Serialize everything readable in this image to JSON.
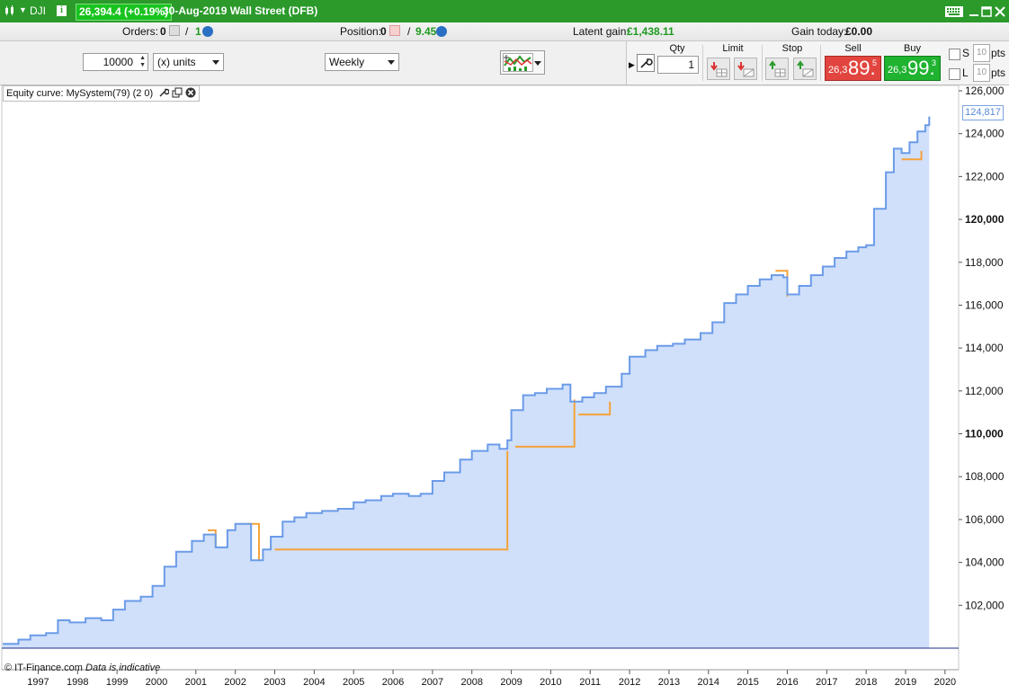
{
  "titlebar": {
    "symbol": "DJI",
    "price_change": "26,394.4 (+0.19%)",
    "market": "30-Aug-2019  Wall Street (DFB)"
  },
  "status": {
    "orders_label": "Orders:",
    "orders_count": "0",
    "orders_sep": "/",
    "orders_pending": "1",
    "position_label": "Position:",
    "position_count": "0",
    "position_sep": "/",
    "position_value": "9.45",
    "latent_label": "Latent gain:",
    "latent_value": "£1,438.11",
    "gain_today_label": "Gain today:",
    "gain_today_value": "£0.00"
  },
  "toolbar": {
    "quantity": "10000",
    "units": "(x) units",
    "period": "Weekly"
  },
  "deal": {
    "qty_label": "Qty",
    "qty_value": "1",
    "limit_label": "Limit",
    "stop_label": "Stop",
    "sell_label": "Sell",
    "buy_label": "Buy",
    "sell_prefix": "26,3",
    "sell_big": "89.",
    "sell_sup": "5",
    "buy_prefix": "26,3",
    "buy_big": "99.",
    "buy_sup": "3",
    "s_label": "S",
    "l_label": "L",
    "pts_value": "10",
    "pts_label": "pts"
  },
  "chart": {
    "legend": "Equity curve: MySystem(79) (2 0)",
    "copyright": "© IT-Finance.com",
    "copyright_note": "Data is indicative",
    "last_value_label": "124,817"
  },
  "chart_data": {
    "type": "area",
    "title": "Equity curve: MySystem(79) (2 0)",
    "xlabel": "",
    "ylabel": "",
    "ylim": [
      100000,
      126000
    ],
    "xlim": [
      1996.1,
      2020.3
    ],
    "x_ticks": [
      "1997",
      "1998",
      "1999",
      "2000",
      "2001",
      "2002",
      "2003",
      "2004",
      "2005",
      "2006",
      "2007",
      "2008",
      "2009",
      "2010",
      "2011",
      "2012",
      "2013",
      "2014",
      "2015",
      "2016",
      "2017",
      "2018",
      "2019",
      "2020"
    ],
    "y_ticks": [
      "102,000",
      "104,000",
      "106,000",
      "108,000",
      "110,000",
      "112,000",
      "114,000",
      "116,000",
      "118,000",
      "120,000",
      "122,000",
      "124,000",
      "126,000"
    ],
    "y_ticks_bold": [
      "110,000",
      "120,000"
    ],
    "colors": {
      "line": "#6b9be8",
      "drawdown": "#f5a23a",
      "fill": "#d0e0fa",
      "baseline": "#1c2c8c"
    },
    "x": [
      1996.1,
      1996.5,
      1996.8,
      1997.2,
      1997.5,
      1997.8,
      1998.2,
      1998.6,
      1998.9,
      1999.2,
      1999.6,
      1999.9,
      2000.2,
      2000.5,
      2000.9,
      2001.2,
      2001.5,
      2001.8,
      2002.0,
      2002.4,
      2002.7,
      2002.9,
      2003.2,
      2003.5,
      2003.8,
      2004.2,
      2004.6,
      2005.0,
      2005.3,
      2005.7,
      2006.0,
      2006.4,
      2006.7,
      2007.0,
      2007.3,
      2007.7,
      2008.0,
      2008.4,
      2008.7,
      2008.9,
      2009.0,
      2009.3,
      2009.6,
      2009.9,
      2010.3,
      2010.5,
      2010.8,
      2011.1,
      2011.4,
      2011.8,
      2012.0,
      2012.4,
      2012.7,
      2013.1,
      2013.4,
      2013.8,
      2014.1,
      2014.4,
      2014.7,
      2015.0,
      2015.3,
      2015.6,
      2015.9,
      2016.0,
      2016.3,
      2016.6,
      2016.9,
      2017.2,
      2017.5,
      2017.8,
      2018.0,
      2018.2,
      2018.5,
      2018.7,
      2018.9,
      2019.1,
      2019.3,
      2019.5,
      2019.6
    ],
    "y": [
      100200,
      100400,
      100600,
      100700,
      101300,
      101200,
      101400,
      101300,
      101800,
      102200,
      102400,
      102900,
      103800,
      104500,
      105000,
      105300,
      104700,
      105500,
      105800,
      104100,
      104600,
      105200,
      105900,
      106100,
      106300,
      106400,
      106500,
      106800,
      106900,
      107100,
      107200,
      107100,
      107200,
      107800,
      108200,
      108800,
      109200,
      109500,
      109300,
      109700,
      111100,
      111800,
      111900,
      112100,
      112300,
      111500,
      111700,
      111900,
      112200,
      112800,
      113600,
      113900,
      114100,
      114200,
      114400,
      114700,
      115200,
      116100,
      116500,
      116900,
      117200,
      117400,
      117300,
      116500,
      116900,
      117400,
      117800,
      118200,
      118500,
      118700,
      118800,
      120500,
      122200,
      123300,
      123100,
      123600,
      124100,
      124400,
      124800
    ],
    "drawdown_x": [
      2001.3,
      2001.5,
      2002.3,
      2002.6,
      2003.0,
      2008.9,
      2009.1,
      2010.6,
      2010.7,
      2011.5,
      2015.7,
      2016.0,
      2018.9,
      2019.4
    ],
    "drawdown_y": [
      105500,
      104700,
      105800,
      104100,
      104600,
      109200,
      109400,
      111600,
      110900,
      111500,
      117600,
      116400,
      122800,
      123200
    ],
    "last_value": 124817
  }
}
